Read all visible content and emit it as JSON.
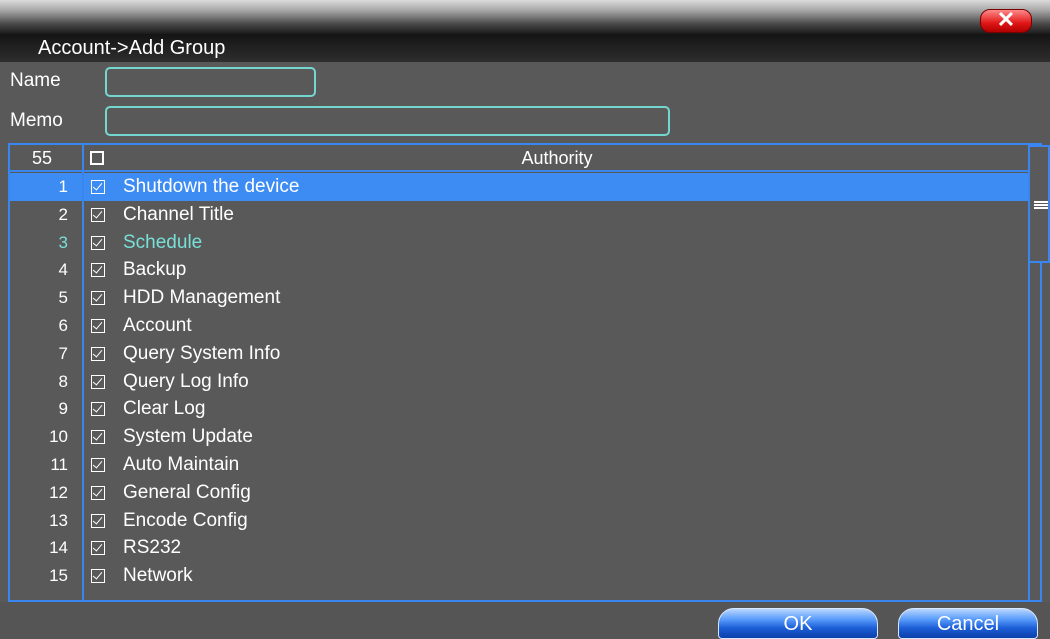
{
  "window": {
    "title": "Account->Add Group",
    "close_symbol": "✕"
  },
  "form": {
    "name_label": "Name",
    "name_value": "",
    "memo_label": "Memo",
    "memo_value": ""
  },
  "list": {
    "count": "55",
    "column_title": "Authority",
    "selected_row": 1,
    "highlight_row": 3,
    "rows": [
      {
        "num": "1",
        "label": "Shutdown the device"
      },
      {
        "num": "2",
        "label": "Channel Title"
      },
      {
        "num": "3",
        "label": "Schedule"
      },
      {
        "num": "4",
        "label": "Backup"
      },
      {
        "num": "5",
        "label": "HDD Management"
      },
      {
        "num": "6",
        "label": "Account"
      },
      {
        "num": "7",
        "label": "Query System Info"
      },
      {
        "num": "8",
        "label": "Query Log Info"
      },
      {
        "num": "9",
        "label": "Clear Log"
      },
      {
        "num": "10",
        "label": "System Update"
      },
      {
        "num": "11",
        "label": "Auto Maintain"
      },
      {
        "num": "12",
        "label": "General Config"
      },
      {
        "num": "13",
        "label": "Encode Config"
      },
      {
        "num": "14",
        "label": "RS232"
      },
      {
        "num": "15",
        "label": "Network"
      }
    ]
  },
  "buttons": {
    "ok": "OK",
    "cancel": "Cancel"
  },
  "colors": {
    "accent": "#3d8cf3",
    "highlight_text": "#79e0d8",
    "input_border": "#73d7d0",
    "close": "#e01616"
  },
  "icons": {
    "close": "close-icon",
    "checkbox": "checkbox-checked-icon",
    "scroll_grip": "scroll-grip-icon"
  }
}
